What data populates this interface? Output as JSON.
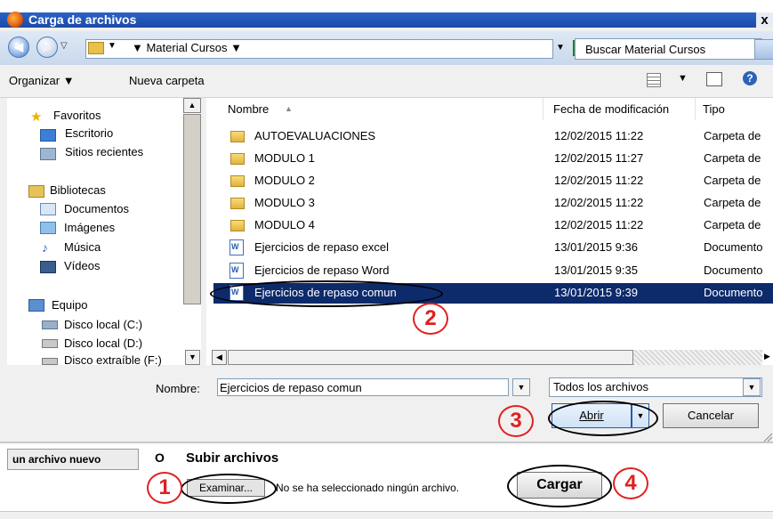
{
  "window": {
    "title": "Carga de archivos",
    "close": "x"
  },
  "address": {
    "path": "▼ Material Cursos ▼",
    "search_placeholder": "Buscar Material Cursos"
  },
  "toolbar": {
    "organize": "Organizar ▼",
    "new_folder": "Nueva carpeta",
    "views_arrow": "▼",
    "help": "?"
  },
  "nav": {
    "items": [
      {
        "label": "Favoritos",
        "icon": "star-icon"
      },
      {
        "label": "Escritorio",
        "icon": "desktop-icon"
      },
      {
        "label": "Sitios recientes",
        "icon": "recent-places-icon"
      },
      {
        "label": "Bibliotecas",
        "icon": "libraries-icon"
      },
      {
        "label": "Documentos",
        "icon": "documents-icon"
      },
      {
        "label": "Imágenes",
        "icon": "pictures-icon"
      },
      {
        "label": "Música",
        "icon": "music-icon"
      },
      {
        "label": "Vídeos",
        "icon": "videos-icon"
      },
      {
        "label": "Equipo",
        "icon": "computer-icon"
      },
      {
        "label": "Disco local (C:)",
        "icon": "drive-icon"
      },
      {
        "label": "Disco local (D:)",
        "icon": "drive-icon"
      },
      {
        "label": "Disco extraíble (F:)",
        "icon": "removable-drive-icon"
      }
    ]
  },
  "columns": {
    "name": "Nombre",
    "date": "Fecha de modificación",
    "type": "Tipo"
  },
  "files": [
    {
      "name": "AUTOEVALUACIONES",
      "date": "12/02/2015 11:22",
      "type": "Carpeta de",
      "kind": "folder"
    },
    {
      "name": "MODULO 1",
      "date": "12/02/2015 11:27",
      "type": "Carpeta de",
      "kind": "folder"
    },
    {
      "name": "MODULO 2",
      "date": "12/02/2015 11:22",
      "type": "Carpeta de",
      "kind": "folder"
    },
    {
      "name": "MODULO 3",
      "date": "12/02/2015 11:22",
      "type": "Carpeta de",
      "kind": "folder"
    },
    {
      "name": "MODULO 4",
      "date": "12/02/2015 11:22",
      "type": "Carpeta de",
      "kind": "folder"
    },
    {
      "name": "Ejercicios de repaso  excel",
      "date": "13/01/2015 9:36",
      "type": "Documento",
      "kind": "doc"
    },
    {
      "name": "Ejercicios de repaso  Word",
      "date": "13/01/2015 9:35",
      "type": "Documento",
      "kind": "doc"
    },
    {
      "name": "Ejercicios de repaso comun",
      "date": "13/01/2015 9:39",
      "type": "Documento",
      "kind": "doc",
      "selected": true
    }
  ],
  "bottom": {
    "name_label": "Nombre:",
    "name_value": "Ejercicios de repaso comun",
    "filter_value": "Todos los archivos",
    "open_label": "Abrir",
    "cancel_label": "Cancelar"
  },
  "page": {
    "tab_label": "un archivo nuevo",
    "radio_symbol": "O",
    "upload_title": "Subir archivos",
    "browse_label": "Examinar...",
    "no_file_text": "No se ha seleccionado ningún archivo.",
    "upload_label": "Cargar"
  },
  "annotations": {
    "steps": [
      "1",
      "2",
      "3",
      "4"
    ],
    "color": "#e02020"
  },
  "colors": {
    "title_bar": "#1b4aa8",
    "selection": "#0d2a6b"
  }
}
